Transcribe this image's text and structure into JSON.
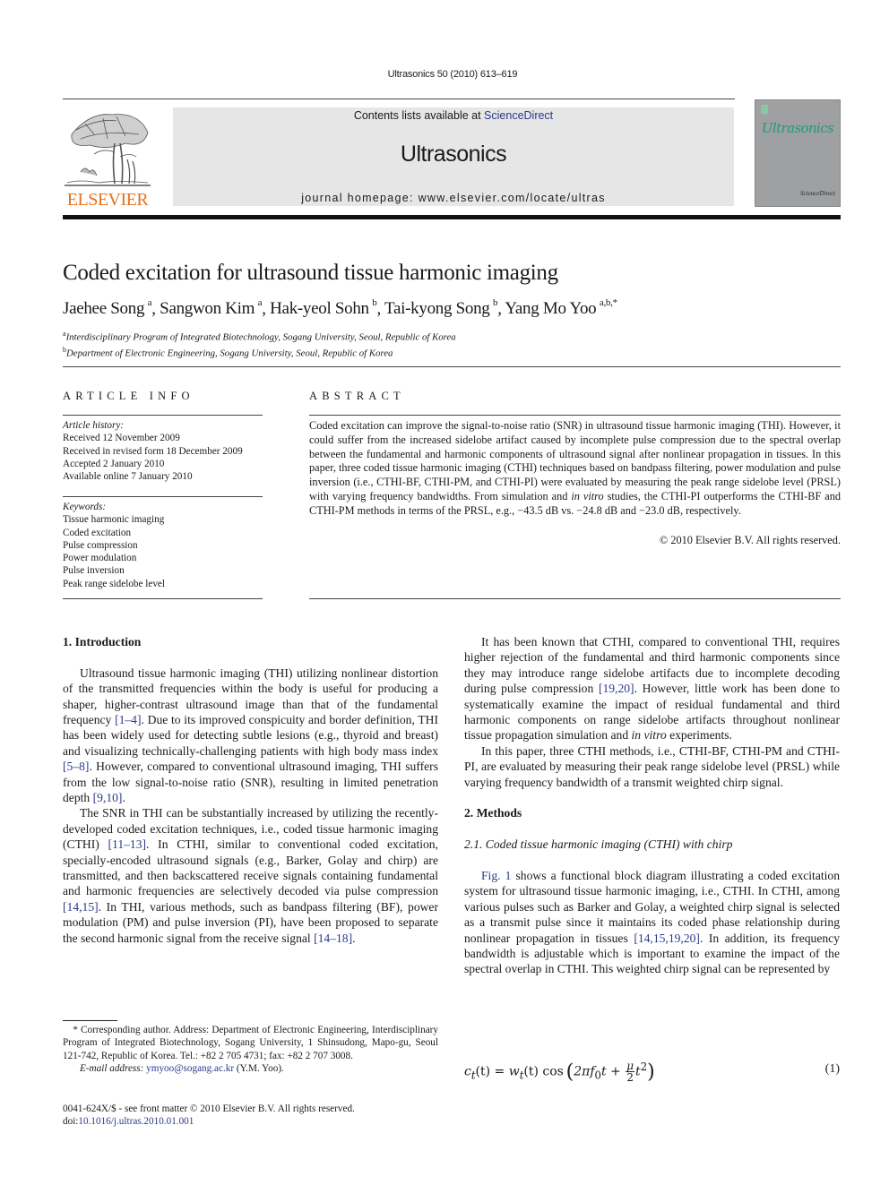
{
  "header": {
    "journal_ref": "Ultrasonics 50 (2010) 613–619",
    "contents_prefix": "Contents lists available at ",
    "contents_link": "ScienceDirect",
    "journal_name": "Ultrasonics",
    "homepage_prefix": "journal homepage: ",
    "homepage_url": "www.elsevier.com/locate/ultras",
    "publisher_logo_text": "ELSEVIER",
    "cover_title": "Ultrasonics",
    "cover_footer": "ScienceDirect",
    "colors": {
      "publisher_orange": "#e8721c",
      "link_blue": "#2a3a8a",
      "cover_teal": "#1f9a7a",
      "header_box_gray": "#e6e6e6"
    }
  },
  "article": {
    "title": "Coded excitation for ultrasound tissue harmonic imaging",
    "authors": [
      {
        "name": "Jaehee Song",
        "sup": "a",
        "sep": ", "
      },
      {
        "name": "Sangwon Kim",
        "sup": "a",
        "sep": ", "
      },
      {
        "name": "Hak-yeol Sohn",
        "sup": "b",
        "sep": ", "
      },
      {
        "name": "Tai-kyong Song",
        "sup": "b",
        "sep": ", "
      },
      {
        "name": "Yang Mo Yoo",
        "sup": "a,b,*",
        "sep": ""
      }
    ],
    "affiliations": [
      {
        "sup": "a",
        "text": "Interdisciplinary Program of Integrated Biotechnology, Sogang University, Seoul, Republic of Korea"
      },
      {
        "sup": "b",
        "text": "Department of Electronic Engineering, Sogang University, Seoul, Republic of Korea"
      }
    ]
  },
  "article_info": {
    "heading": "ARTICLE INFO",
    "history_label": "Article history:",
    "history": [
      "Received 12 November 2009",
      "Received in revised form 18 December 2009",
      "Accepted 2 January 2010",
      "Available online 7 January 2010"
    ],
    "keywords_label": "Keywords:",
    "keywords": [
      "Tissue harmonic imaging",
      "Coded excitation",
      "Pulse compression",
      "Power modulation",
      "Pulse inversion",
      "Peak range sidelobe level"
    ]
  },
  "abstract": {
    "heading": "ABSTRACT",
    "p1": "Coded excitation can improve the signal-to-noise ratio (SNR) in ultrasound tissue harmonic imaging (THI). However, it could suffer from the increased sidelobe artifact caused by incomplete pulse compres­sion due to the spectral overlap between the fundamental and harmonic components of ultrasound signal after nonlinear propagation in tissues. In this paper, three coded tissue harmonic imaging (CTHI) tech­niques based on bandpass filtering, power modulation and pulse inversion (i.e., CTHI-BF, CTHI-PM, and CTHI-PI) were evaluated by measuring the peak range sidelobe level (PRSL) with varying frequency band­widths. From simulation and ",
    "p1_italic": "in vitro",
    "p1_end": " studies, the CTHI-PI outperforms the CTHI-BF and CTHI-PM methods in terms of the PRSL, e.g., −43.5 dB vs. −24.8 dB and −23.0 dB, respectively.",
    "copyright": "© 2010 Elsevier B.V. All rights reserved."
  },
  "body": {
    "intro_heading": "1. Introduction",
    "intro_p1": [
      {
        "t": "Ultrasound tissue harmonic imaging (THI) utilizing nonlinear distortion of the transmitted frequencies within the body is useful for producing a shaper, higher-contrast ultrasound image than that of the fundamental frequency "
      },
      {
        "link": "[1–4]"
      },
      {
        "t": ". Due to its improved conspicu­ity and border definition, THI has been widely used for detecting subtle lesions (e.g., thyroid and breast) and visualizing techni­cally-challenging patients with high body mass index "
      },
      {
        "link": "[5–8]"
      },
      {
        "t": ". How­ever, compared to conventional ultrasound imaging, THI suffers from the low signal-to-noise ratio (SNR), resulting in limited pen­etration depth "
      },
      {
        "link": "[9,10]"
      },
      {
        "t": "."
      }
    ],
    "intro_p2": [
      {
        "t": "The SNR in THI can be substantially increased by utilizing the recently-developed coded excitation techniques, i.e., coded tissue harmonic imaging (CTHI) "
      },
      {
        "link": "[11–13]"
      },
      {
        "t": ". In CTHI, similar to conventional coded excitation, specially-encoded ultrasound signals (e.g., Bar­ker, Golay and chirp) are transmitted, and then backscattered re­ceive signals containing fundamental and harmonic frequencies are selectively decoded via pulse compression "
      },
      {
        "link": "[14,15]"
      },
      {
        "t": ". In THI, var­ious methods, such as bandpass filtering (BF), power modulation (PM) and pulse inversion (PI), have been proposed to separate the second harmonic signal from the receive signal "
      },
      {
        "link": "[14–18]"
      },
      {
        "t": "."
      }
    ],
    "intro_p3": [
      {
        "t": "It has been known that CTHI, compared to conventional THI, re­quires higher rejection of the fundamental and third harmonic components since they may introduce range sidelobe artifacts due to incomplete decoding during pulse compression "
      },
      {
        "link": "[19,20]"
      },
      {
        "t": ". However, little work has been done to systematically examine the impact of residual fundamental and third harmonic compo­nents on range sidelobe artifacts throughout nonlinear tissue prop­agation simulation and "
      },
      {
        "i": "in vitro"
      },
      {
        "t": " experiments."
      }
    ],
    "intro_p4": [
      {
        "t": "In this paper, three CTHI methods, i.e., CTHI-BF, CTHI-PM and CTHI-PI, are evaluated by measuring their peak range sidelobe le­vel (PRSL) while varying frequency bandwidth of a transmit weighted chirp signal."
      }
    ],
    "methods_heading": "2. Methods",
    "methods_sub": "2.1. Coded tissue harmonic imaging (CTHI) with chirp",
    "methods_p1": [
      {
        "link": "Fig. 1"
      },
      {
        "t": " shows a functional block diagram illustrating a coded excitation system for ultrasound tissue harmonic imaging, i.e., CTHI. In CTHI, among various pulses such as Barker and Golay, a weighted chirp signal is selected as a transmit pulse since it main­tains its coded phase relationship during nonlinear propagation in tissues "
      },
      {
        "link": "[14,15,19,20]"
      },
      {
        "t": ". In addition, its frequency bandwidth is adjustable which is important to examine the impact of the spec­tral overlap in CTHI. This weighted chirp signal can be represented by"
      }
    ],
    "equation": {
      "lhs": "c",
      "lhs_sub": "t",
      "lhs_arg": "(t) = ",
      "w": "w",
      "w_sub": "t",
      "w_arg": "(t) ",
      "cos": "cos",
      "inner_a": "2πf",
      "inner_sub": "0",
      "inner_b": "t + ",
      "frac_num": "μ",
      "frac_den": "2",
      "inner_c": "t",
      "inner_sup": "2",
      "number": "(1)"
    }
  },
  "footnote": {
    "marker": "*",
    "text": " Corresponding author. Address: Department of Electronic Engineering, Inter­disciplinary Program of Integrated Biotechnology, Sogang University, 1 Shinsu­dong, Mapo-gu, Seoul 121-742, Republic of Korea. Tel.: +82 2 705 4731; fax: +82 2 707 3008.",
    "email_label": "E-mail address: ",
    "email": "ymyoo@sogang.ac.kr",
    "email_owner": " (Y.M. Yoo).",
    "issn_line": "0041-624X/$ - see front matter © 2010 Elsevier B.V. All rights reserved.",
    "doi_prefix": "doi:",
    "doi": "10.1016/j.ultras.2010.01.001"
  }
}
